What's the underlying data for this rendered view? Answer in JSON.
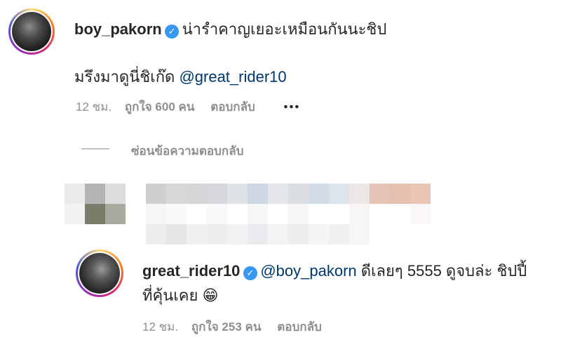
{
  "comment": {
    "username": "boy_pakorn",
    "text": "น่ารำคาญเยอะเหมือนกันนะชิป",
    "reply_text": "มรึงมาดูนี่ชิเก๊ด",
    "mention": "@great_rider10",
    "time": "12 ชม.",
    "likes": "ถูกใจ 600 คน",
    "reply_label": "ตอบกลับ",
    "more": "•••"
  },
  "hide_replies_label": "ซ่อนข้อความตอบกลับ",
  "reply": {
    "username": "great_rider10",
    "mention": "@boy_pakorn",
    "text_line1": " ดีเลยๆ 5555 ดูจบล่ะ ชิปปี้",
    "text_line2": "ที่คุ้นเคย",
    "emoji": "😁",
    "time": "12 ชม.",
    "likes": "ถูกใจ 253 คน",
    "reply_label": "ตอบกลับ"
  },
  "colors": {
    "mention": "#00376b",
    "verified": "#3897f0",
    "meta": "#8e8e8e"
  }
}
